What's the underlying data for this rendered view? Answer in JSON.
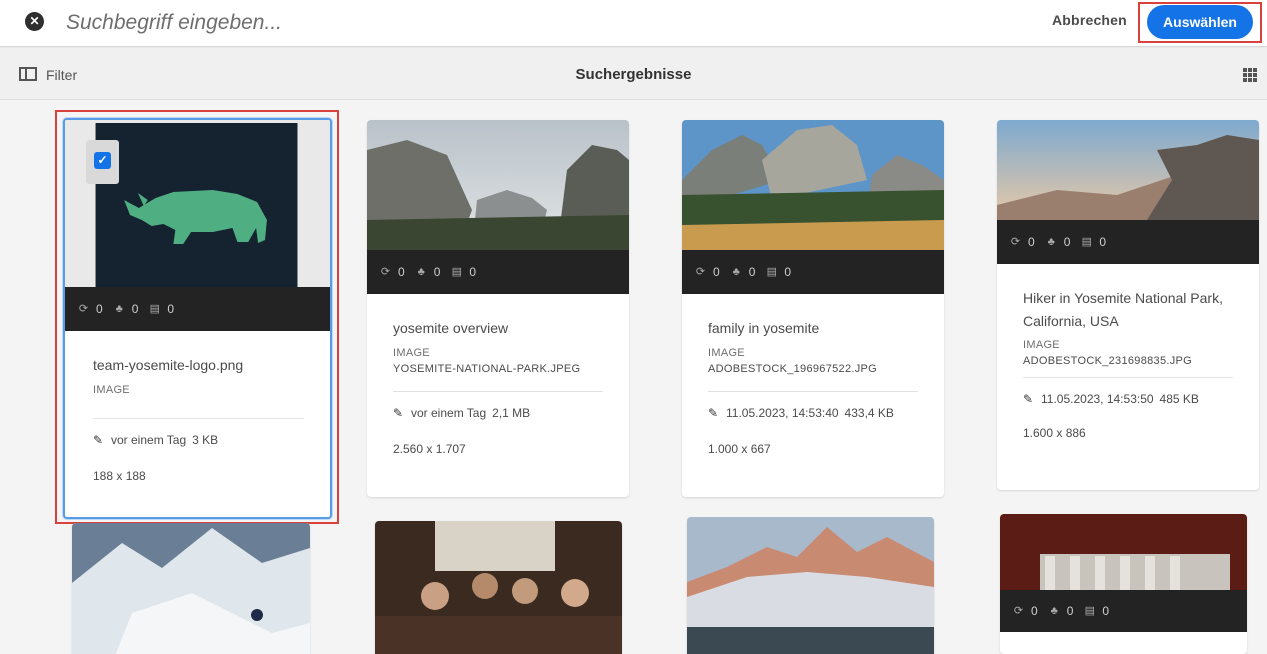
{
  "search": {
    "placeholder": "Suchbegriff eingeben..."
  },
  "toolbar": {
    "cancel_label": "Abbrechen",
    "select_label": "Auswählen"
  },
  "actionbar": {
    "filter_label": "Filter",
    "title": "Suchergebnisse"
  },
  "cards": [
    {
      "title": "team-yosemite-logo.png",
      "type": "IMAGE",
      "filename": "",
      "modified": "vor einem Tag",
      "size": "3 KB",
      "dimensions": "188 x 188",
      "stats": [
        "0",
        "0",
        "0"
      ],
      "selected": true
    },
    {
      "title": "yosemite overview",
      "type": "IMAGE",
      "filename": "YOSEMITE-NATIONAL-PARK.JPEG",
      "modified": "vor einem Tag",
      "size": "2,1 MB",
      "dimensions": "2.560 x 1.707",
      "stats": [
        "0",
        "0",
        "0"
      ]
    },
    {
      "title": "family in yosemite",
      "type": "IMAGE",
      "filename": "ADOBESTOCK_196967522.JPG",
      "modified": "11.05.2023, 14:53:40",
      "size": "433,4 KB",
      "dimensions": "1.000 x 667",
      "stats": [
        "0",
        "0",
        "0"
      ]
    },
    {
      "title": "Hiker in Yosemite National Park, California, USA",
      "type": "IMAGE",
      "filename": "ADOBESTOCK_231698835.JPG",
      "modified": "11.05.2023, 14:53:50",
      "size": "485 KB",
      "dimensions": "1.600 x 886",
      "stats": [
        "0",
        "0",
        "0"
      ]
    },
    {
      "stats": [
        "0",
        "0",
        "0"
      ]
    }
  ],
  "icons": [
    "close-icon",
    "filter-icon",
    "grid-view-icon",
    "refresh-icon",
    "people-icon",
    "comment-icon",
    "pencil-icon",
    "checkbox-icon"
  ],
  "colors": {
    "accent": "#1473e6",
    "highlight": "#d9413c",
    "status_bar": "#232323"
  }
}
